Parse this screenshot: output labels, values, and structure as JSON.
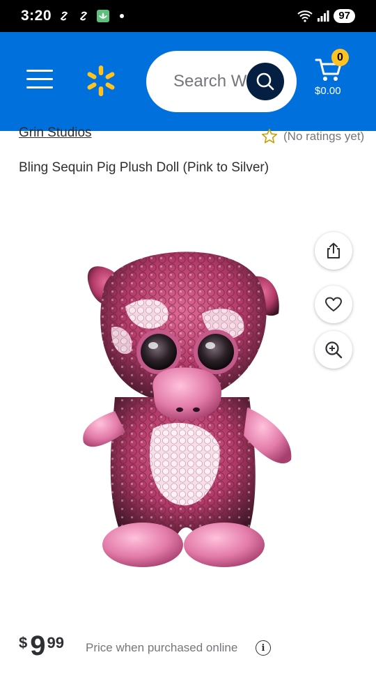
{
  "status_bar": {
    "time": "3:20",
    "battery": "97"
  },
  "header": {
    "search_placeholder": "Search Walmart",
    "search_visible_text": "Search W",
    "cart_count": "0",
    "cart_total": "$0.00",
    "colors": {
      "brand_blue": "#0071dc",
      "spark_yellow": "#ffc220",
      "search_button": "#041f41"
    }
  },
  "product": {
    "brand": "Grin Studios",
    "rating_text": "(No ratings yet)",
    "title": "Bling Sequin Pig Plush Doll (Pink to Silver)",
    "price": {
      "currency": "$",
      "dollars": "9",
      "cents": "99",
      "note": "Price when purchased online"
    }
  },
  "icons": [
    "menu-icon",
    "walmart-spark-icon",
    "search-icon",
    "cart-icon",
    "star-icon",
    "share-icon",
    "heart-icon",
    "zoom-in-icon",
    "info-icon"
  ]
}
